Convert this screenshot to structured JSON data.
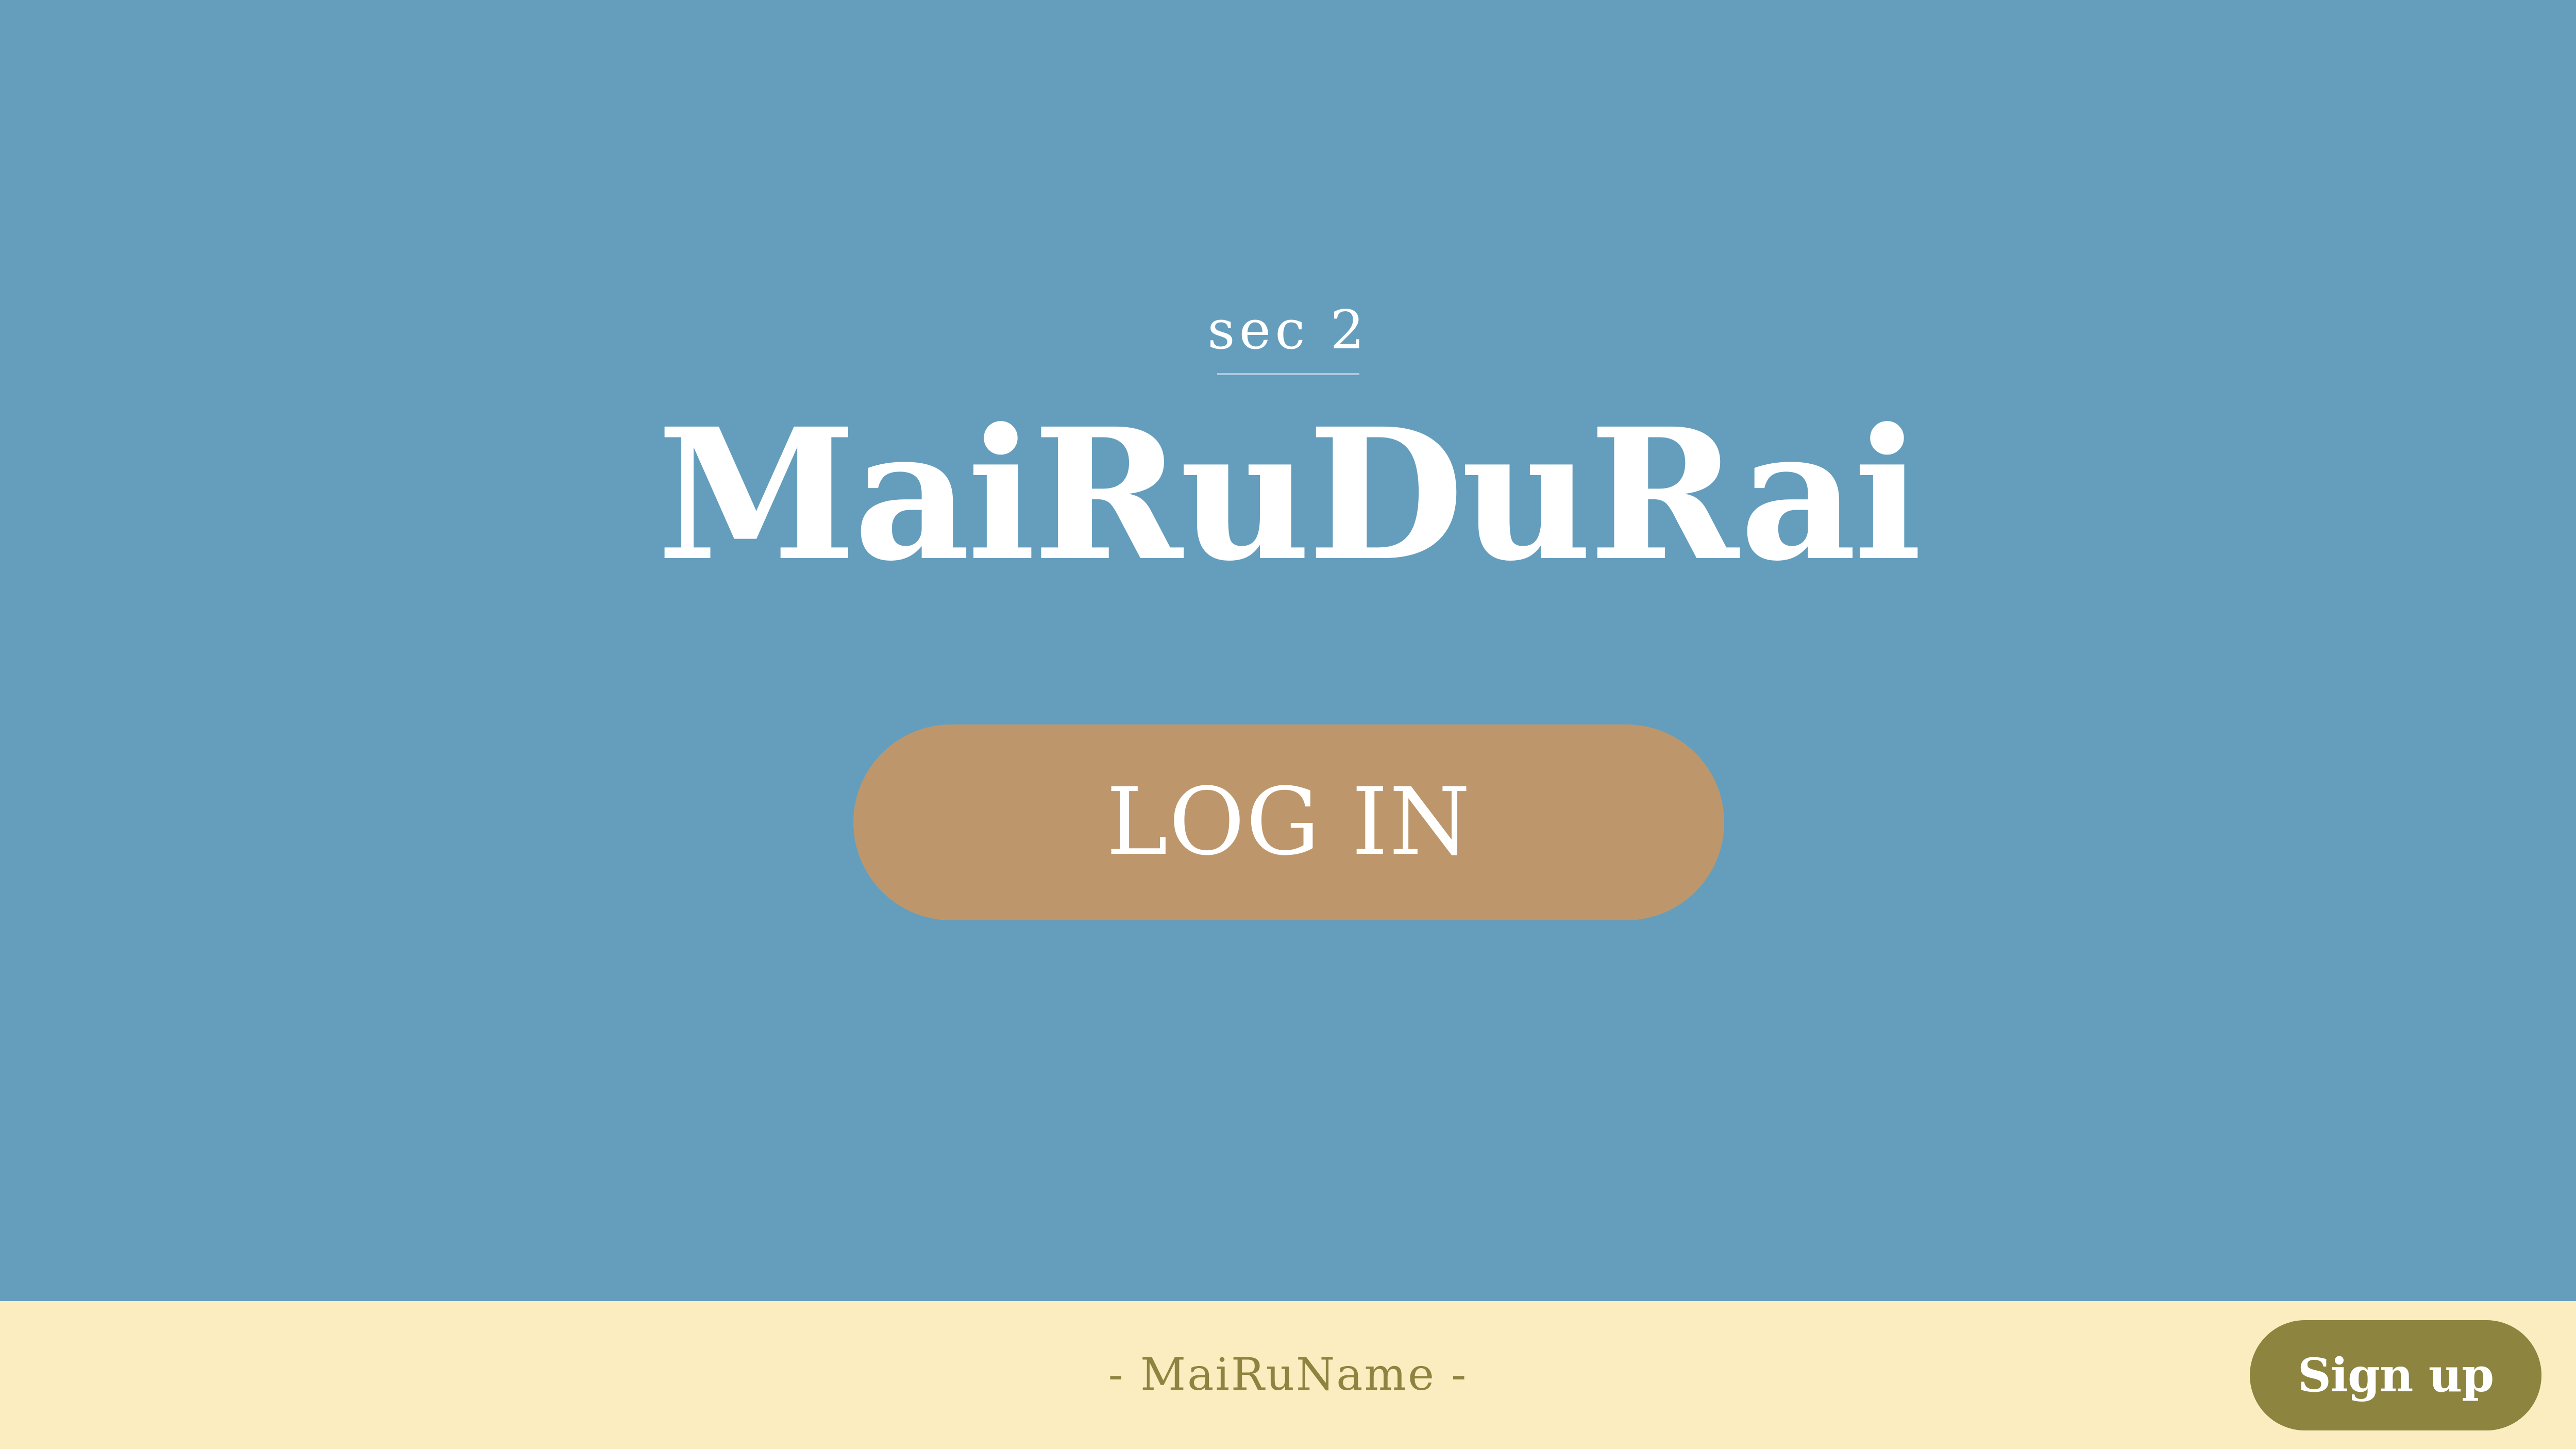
{
  "colors": {
    "hero_background": "#659ebd",
    "login_button": "#bd976b",
    "footer_background": "#fcedc0",
    "footer_accent": "#8c843f",
    "text_light": "#ffffff"
  },
  "hero": {
    "eyebrow": "sec 2",
    "brand": "MaiRuDuRai",
    "login_label": "LOG IN"
  },
  "footer": {
    "name": "- MaiRuName -",
    "signup_label": "Sign up"
  }
}
